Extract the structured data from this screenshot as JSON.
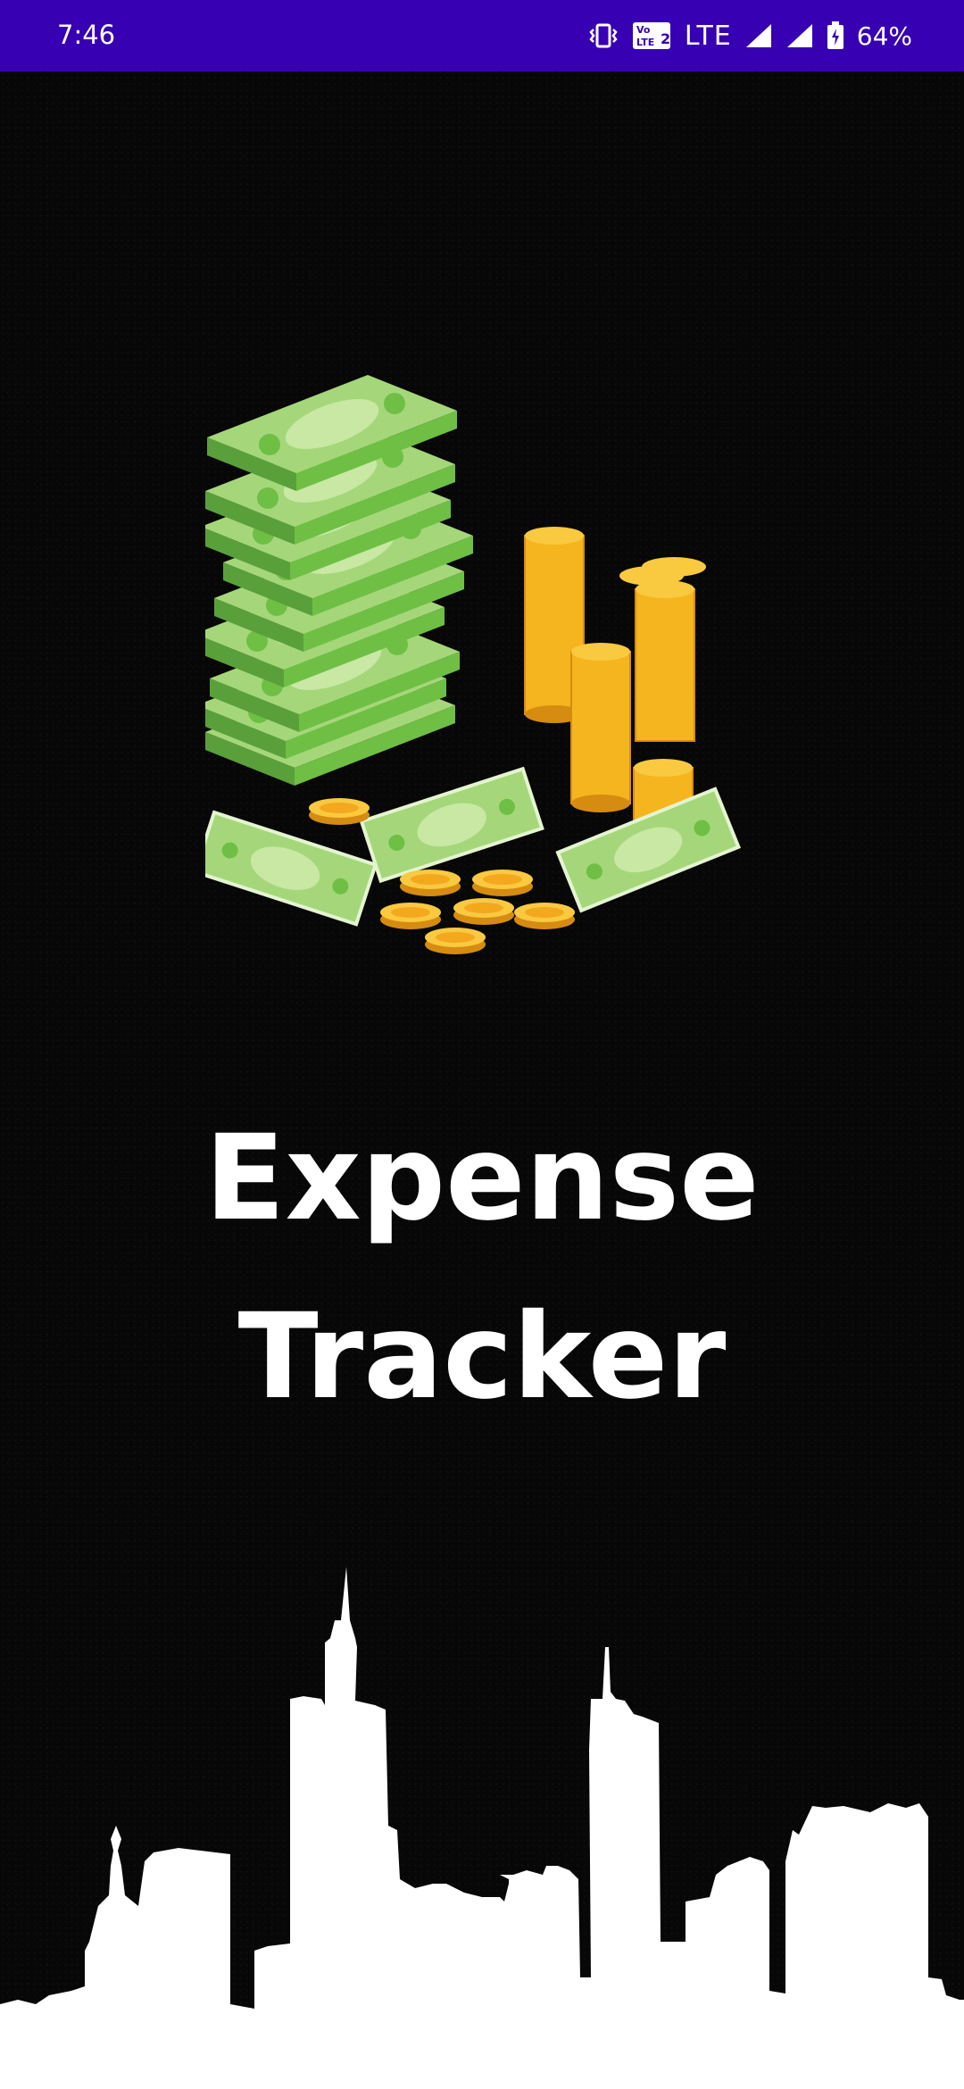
{
  "status_bar": {
    "time": "7:46",
    "network": "LTE",
    "battery": "64%",
    "color": "#3700b3",
    "icons": [
      "vibrate-icon",
      "volte2-icon",
      "signal-icon",
      "signal-icon",
      "battery-charging-icon"
    ]
  },
  "app": {
    "title_line1": "Expense",
    "title_line2": "Tracker"
  },
  "colors": {
    "background": "#070707",
    "title": "#ffffff",
    "money_green": "#7ec850",
    "coin_gold": "#f7b721",
    "skyline": "#ffffff"
  }
}
